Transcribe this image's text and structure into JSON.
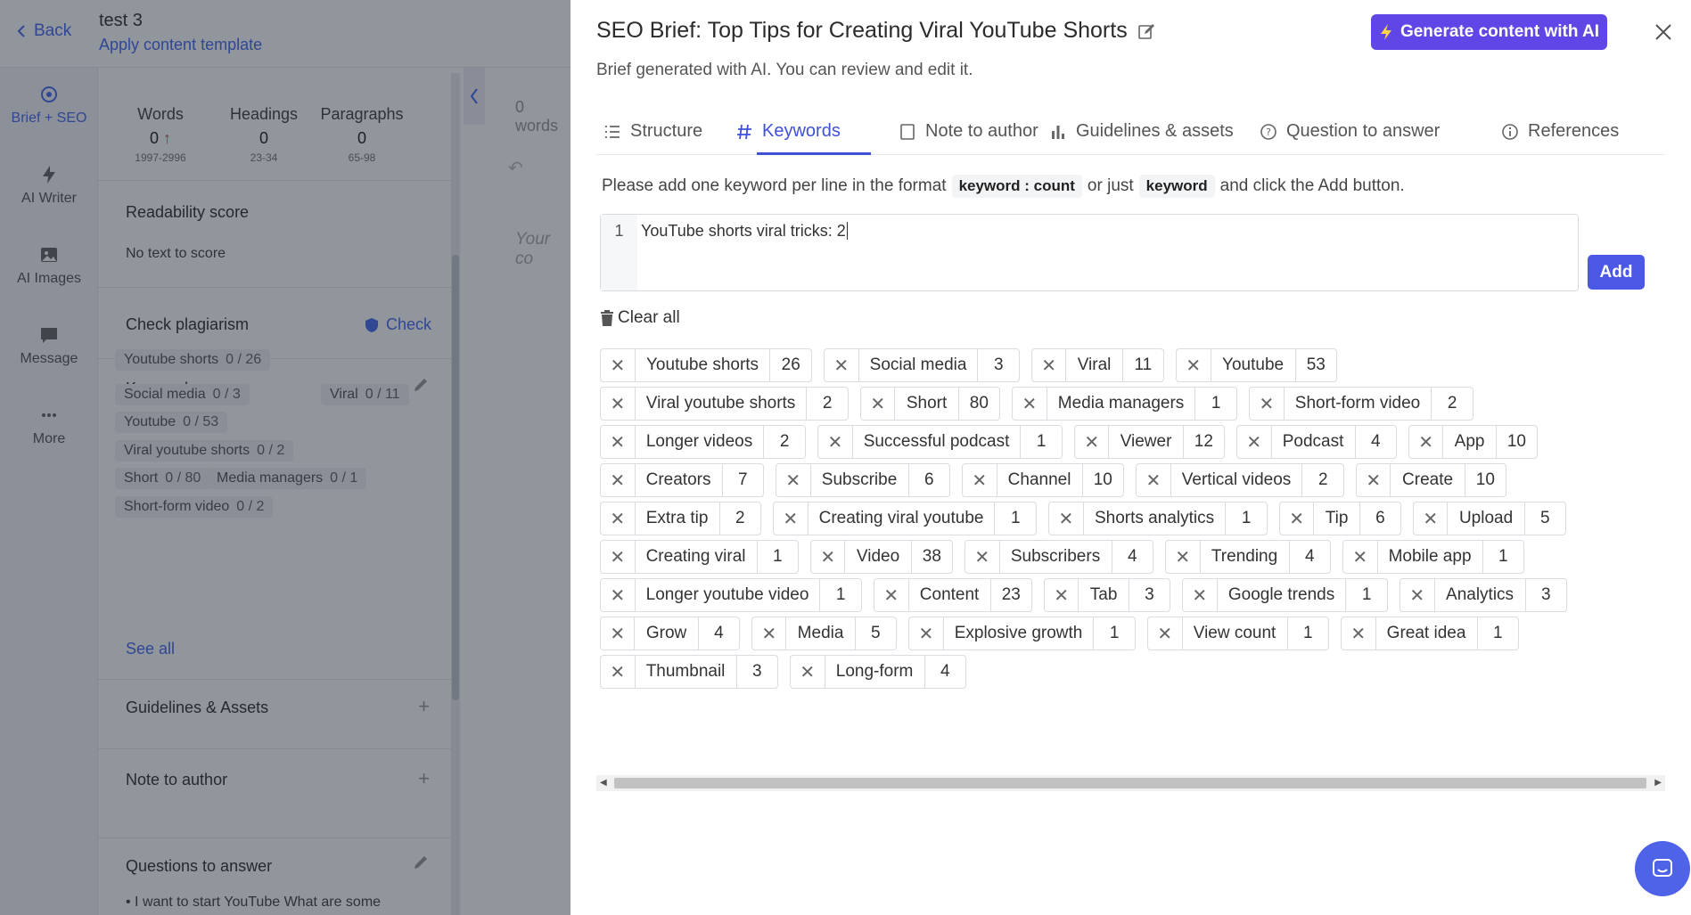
{
  "background_app": {
    "back_label": "Back",
    "doc_title": "test 3",
    "apply_template_label": "Apply content template",
    "nav": [
      {
        "label": "Brief + SEO",
        "icon": "target-icon",
        "active": true
      },
      {
        "label": "AI Writer",
        "icon": "bolt-icon"
      },
      {
        "label": "AI Images",
        "icon": "image-icon"
      },
      {
        "label": "Message",
        "icon": "chat-icon"
      },
      {
        "label": "More",
        "icon": "dots-icon"
      }
    ],
    "stats": [
      {
        "label": "Words",
        "value": "0",
        "range": "1997-2996",
        "trend": "↑"
      },
      {
        "label": "Headings",
        "value": "0",
        "range": "23-34"
      },
      {
        "label": "Paragraphs",
        "value": "0",
        "range": "65-98"
      }
    ],
    "readability": {
      "title": "Readability score",
      "text": "No text to score"
    },
    "plagiarism": {
      "title": "Check plagiarism",
      "action": "Check"
    },
    "keywords": {
      "title": "Keywords",
      "items": [
        {
          "name": "Youtube shorts",
          "count": "0 / 26"
        },
        {
          "name": "Social media",
          "count": "0 / 3"
        },
        {
          "name": "Viral",
          "count": "0 / 11"
        },
        {
          "name": "Youtube",
          "count": "0 / 53"
        },
        {
          "name": "Viral youtube shorts",
          "count": "0 / 2"
        },
        {
          "name": "Short",
          "count": "0 / 80"
        },
        {
          "name": "Media managers",
          "count": "0 / 1"
        },
        {
          "name": "Short-form video",
          "count": "0 / 2"
        }
      ],
      "see_all": "See all"
    },
    "guidelines_title": "Guidelines & Assets",
    "note_title": "Note to author",
    "questions_title": "Questions to answer",
    "question_item": "I want to start YouTube What are some",
    "words_count": "0 words",
    "editor_placeholder": "Your co"
  },
  "drawer": {
    "title": "SEO Brief: Top Tips for Creating Viral YouTube Shorts",
    "subtitle": "Brief generated with AI. You can review and edit it.",
    "generate_label": "Generate content with AI",
    "tabs": [
      {
        "label": "Structure",
        "icon": "list-icon"
      },
      {
        "label": "Keywords",
        "icon": "hash-icon",
        "active": true
      },
      {
        "label": "Note to author",
        "icon": "note-icon"
      },
      {
        "label": "Guidelines & assets",
        "icon": "bar-chart-icon"
      },
      {
        "label": "Question to answer",
        "icon": "help-circle-icon"
      },
      {
        "label": "References",
        "icon": "info-icon"
      }
    ],
    "instructions": {
      "before": "Please add one keyword per line in the format",
      "code1": "keyword : count",
      "middle": "or just",
      "code2": "keyword",
      "after": "and click the Add button."
    },
    "editor": {
      "line_number": "1",
      "value": "YouTube shorts viral tricks: 2"
    },
    "add_label": "Add",
    "clear_all_label": "Clear all",
    "keyword_rows": [
      [
        [
          "Youtube shorts",
          "26"
        ],
        [
          "Social media",
          "3"
        ],
        [
          "Viral",
          "11"
        ],
        [
          "Youtube",
          "53"
        ]
      ],
      [
        [
          "Viral youtube shorts",
          "2"
        ],
        [
          "Short",
          "80"
        ],
        [
          "Media managers",
          "1"
        ],
        [
          "Short-form video",
          "2"
        ]
      ],
      [
        [
          "Longer videos",
          "2"
        ],
        [
          "Successful podcast",
          "1"
        ],
        [
          "Viewer",
          "12"
        ],
        [
          "Podcast",
          "4"
        ],
        [
          "App",
          "10"
        ]
      ],
      [
        [
          "Creators",
          "7"
        ],
        [
          "Subscribe",
          "6"
        ],
        [
          "Channel",
          "10"
        ],
        [
          "Vertical videos",
          "2"
        ],
        [
          "Create",
          "10"
        ]
      ],
      [
        [
          "Extra tip",
          "2"
        ],
        [
          "Creating viral youtube",
          "1"
        ],
        [
          "Shorts analytics",
          "1"
        ],
        [
          "Tip",
          "6"
        ],
        [
          "Upload",
          "5"
        ]
      ],
      [
        [
          "Creating viral",
          "1"
        ],
        [
          "Video",
          "38"
        ],
        [
          "Subscribers",
          "4"
        ],
        [
          "Trending",
          "4"
        ],
        [
          "Mobile app",
          "1"
        ]
      ],
      [
        [
          "Longer youtube video",
          "1"
        ],
        [
          "Content",
          "23"
        ],
        [
          "Tab",
          "3"
        ],
        [
          "Google trends",
          "1"
        ],
        [
          "Analytics",
          "3"
        ]
      ],
      [
        [
          "Grow",
          "4"
        ],
        [
          "Media",
          "5"
        ],
        [
          "Explosive growth",
          "1"
        ],
        [
          "View count",
          "1"
        ],
        [
          "Great idea",
          "1"
        ]
      ],
      [
        [
          "Thumbnail",
          "3"
        ],
        [
          "Long-form",
          "4"
        ]
      ]
    ]
  },
  "colors": {
    "primary": "#4b58e6",
    "generate_button": "#6046e6",
    "active_tab": "#3f51d8",
    "link": "#4a6cf0"
  }
}
